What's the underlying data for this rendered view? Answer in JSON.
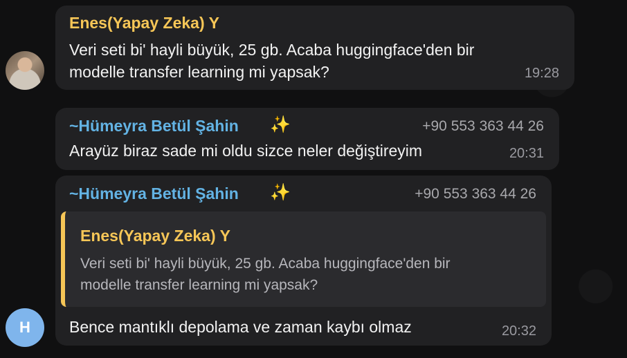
{
  "messages": [
    {
      "sender": "Enes(Yapay Zeka) Y",
      "lines": [
        "Veri seti bi' hayli büyük, 25 gb. Acaba huggingface'den bir",
        "modelle transfer learning mi yapsak?"
      ],
      "time": "19:28"
    },
    {
      "sender": "~Hümeyra Betül Şahin",
      "sparkle": "✨",
      "phone": "+90 553 363 44 26",
      "text": "Arayüz biraz sade mi oldu sizce neler değiştireyim",
      "time": "20:31"
    },
    {
      "sender": "~Hümeyra Betül Şahin",
      "sparkle": "✨",
      "phone": "+90 553 363 44 26",
      "reply": {
        "sender": "Enes(Yapay Zeka) Y",
        "lines": [
          "Veri seti bi' hayli büyük, 25 gb. Acaba huggingface'den bir",
          "modelle transfer learning mi yapsak?"
        ]
      },
      "text": "Bence mantıklı depolama ve zaman kaybı olmaz",
      "time": "20:32"
    }
  ],
  "avatars": {
    "second_initial": "H",
    "second_color": "#7fb5ec"
  },
  "colors": {
    "yellow_name": "#f6c657",
    "blue_name": "#63b3e4",
    "bubble": "#212123"
  }
}
